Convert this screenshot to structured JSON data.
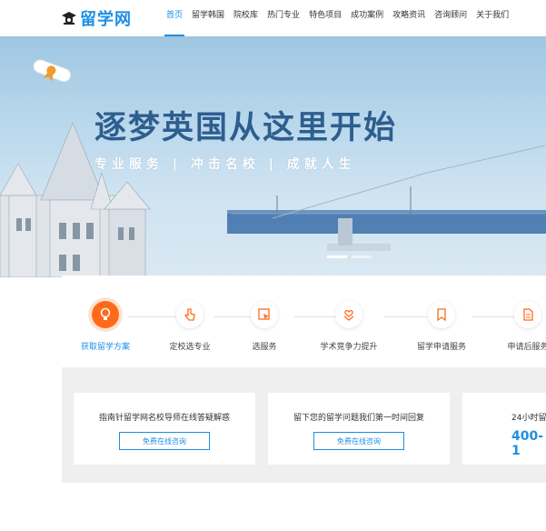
{
  "header": {
    "logo_text": "留学网",
    "nav": [
      "首页",
      "留学韩国",
      "院校库",
      "热门专业",
      "特色项目",
      "成功案例",
      "攻略资讯",
      "咨询顾问",
      "关于我们"
    ],
    "active_index": 0
  },
  "banner": {
    "title": "逐梦英国从这里开始",
    "subtitle": "专业服务 | 冲击名校 | 成就人生"
  },
  "process": {
    "steps": [
      {
        "label": "获取留学方案",
        "icon": "lightbulb-icon"
      },
      {
        "label": "定校选专业",
        "icon": "hand-pointer-icon"
      },
      {
        "label": "选服务",
        "icon": "cursor-box-icon"
      },
      {
        "label": "学术竞争力提升",
        "icon": "heart-hands-icon"
      },
      {
        "label": "留学申请服务",
        "icon": "bookmark-icon"
      },
      {
        "label": "申请后服务",
        "icon": "document-icon"
      }
    ]
  },
  "cards": [
    {
      "text": "指南针留学网名校导师在线答疑解惑",
      "button": "免费在线咨询"
    },
    {
      "text": "留下您的留学问题我们第一时间回复",
      "button": "免费在线咨询"
    },
    {
      "text": "24小时留",
      "big": "400-1"
    }
  ],
  "colors": {
    "accent": "#1e8fe6",
    "orange": "#ff6a1a",
    "title": "#2d5e8e"
  }
}
